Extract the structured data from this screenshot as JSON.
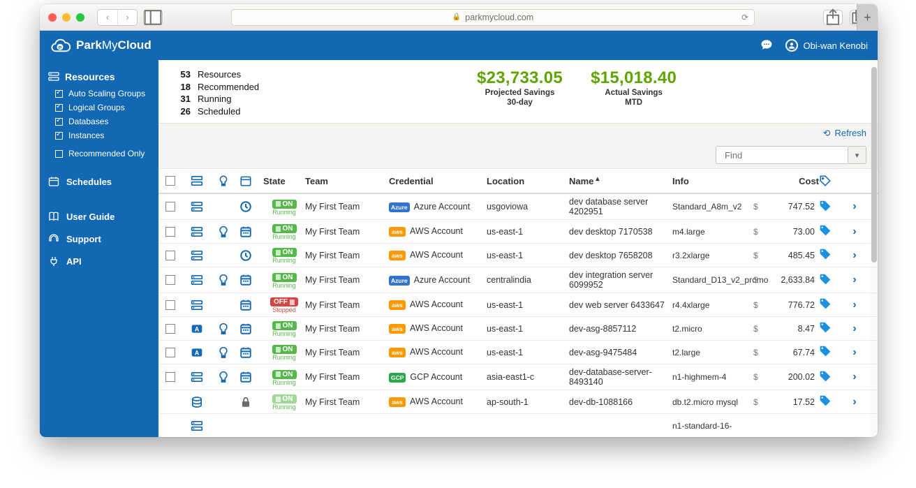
{
  "browser": {
    "url_text": "parkmycloud.com"
  },
  "header": {
    "brand_strong": "Park",
    "brand_mid": "My",
    "brand_end": "Cloud",
    "user_name": "Obi-wan Kenobi"
  },
  "sidebar": {
    "resources_label": "Resources",
    "auto_scaling": "Auto Scaling Groups",
    "logical_groups": "Logical Groups",
    "databases": "Databases",
    "instances": "Instances",
    "recommended_only": "Recommended Only",
    "schedules": "Schedules",
    "user_guide": "User Guide",
    "support": "Support",
    "api": "API"
  },
  "summary": {
    "count_resources_n": "53",
    "count_resources_l": "Resources",
    "count_recommended_n": "18",
    "count_recommended_l": "Recommended",
    "count_running_n": "31",
    "count_running_l": "Running",
    "count_scheduled_n": "26",
    "count_scheduled_l": "Scheduled",
    "proj_amount": "$23,733.05",
    "proj_label": "Projected Savings",
    "proj_sub": "30-day",
    "actual_amount": "$15,018.40",
    "actual_label": "Actual Savings",
    "actual_sub": "MTD"
  },
  "toolbar": {
    "refresh": "Refresh",
    "find_placeholder": "Find"
  },
  "table": {
    "headers": {
      "state": "State",
      "team": "Team",
      "credential": "Credential",
      "location": "Location",
      "name": "Name",
      "info": "Info",
      "cost": "Cost"
    },
    "rows": [
      {
        "type_icon": "instance",
        "bulb": false,
        "sched": "clock",
        "state": "on",
        "state_sub": "Running",
        "team": "My First Team",
        "cred_provider": "azure",
        "cred_badge": "Azure",
        "cred_label": "Azure Account",
        "location": "usgoviowa",
        "name": "dev database server 4202951",
        "info": "Standard_A8m_v2",
        "cost": "747.52"
      },
      {
        "type_icon": "instance",
        "bulb": true,
        "sched": "calendar",
        "state": "on",
        "state_sub": "Running",
        "team": "My First Team",
        "cred_provider": "aws",
        "cred_badge": "aws",
        "cred_label": "AWS Account",
        "location": "us-east-1",
        "name": "dev desktop 7170538",
        "info": "m4.large",
        "cost": "73.00"
      },
      {
        "type_icon": "instance",
        "bulb": false,
        "sched": "clock",
        "state": "on",
        "state_sub": "Running",
        "team": "My First Team",
        "cred_provider": "aws",
        "cred_badge": "aws",
        "cred_label": "AWS Account",
        "location": "us-east-1",
        "name": "dev desktop 7658208",
        "info": "r3.2xlarge",
        "cost": "485.45"
      },
      {
        "type_icon": "instance",
        "bulb": true,
        "sched": "calendar",
        "state": "on",
        "state_sub": "Running",
        "team": "My First Team",
        "cred_provider": "azure",
        "cred_badge": "Azure",
        "cred_label": "Azure Account",
        "location": "centralindia",
        "name": "dev integration server 6099952",
        "info": "Standard_D13_v2_promo",
        "cost": "2,633.84"
      },
      {
        "type_icon": "instance",
        "bulb": false,
        "sched": "calendar",
        "state": "off",
        "state_sub": "Stopped",
        "team": "My First Team",
        "cred_provider": "aws",
        "cred_badge": "aws",
        "cred_label": "AWS Account",
        "location": "us-east-1",
        "name": "dev web server 6433647",
        "info": "r4.4xlarge",
        "cost": "776.72"
      },
      {
        "type_icon": "asg",
        "bulb": true,
        "sched": "calendar",
        "state": "on",
        "state_sub": "Running",
        "team": "My First Team",
        "cred_provider": "aws",
        "cred_badge": "aws",
        "cred_label": "AWS Account",
        "location": "us-east-1",
        "name": "dev-asg-8857112",
        "info": "t2.micro",
        "cost": "8.47"
      },
      {
        "type_icon": "asg",
        "bulb": true,
        "sched": "calendar",
        "state": "on",
        "state_sub": "Running",
        "team": "My First Team",
        "cred_provider": "aws",
        "cred_badge": "aws",
        "cred_label": "AWS Account",
        "location": "us-east-1",
        "name": "dev-asg-9475484",
        "info": "t2.large",
        "cost": "67.74"
      },
      {
        "type_icon": "instance",
        "bulb": true,
        "sched": "calendar",
        "state": "on",
        "state_sub": "Running",
        "team": "My First Team",
        "cred_provider": "gcp",
        "cred_badge": "GCP",
        "cred_label": "GCP Account",
        "location": "asia-east1-c",
        "name": "dev-database-server-8493140",
        "info": "n1-highmem-4",
        "cost": "200.02"
      },
      {
        "type_icon": "db",
        "bulb": false,
        "sched": "lock",
        "state": "on-faded",
        "state_sub": "Running",
        "team": "My First Team",
        "cred_provider": "aws",
        "cred_badge": "aws",
        "cred_label": "AWS Account",
        "location": "ap-south-1",
        "name": "dev-db-1088166",
        "info": "db.t2.micro mysql",
        "cost": "17.52"
      },
      {
        "type_icon": "instance",
        "bulb": false,
        "sched": "",
        "state": "",
        "state_sub": "",
        "team": "",
        "cred_provider": "",
        "cred_badge": "",
        "cred_label": "",
        "location": "",
        "name": "",
        "info": "n1-standard-16-",
        "cost": ""
      }
    ]
  }
}
